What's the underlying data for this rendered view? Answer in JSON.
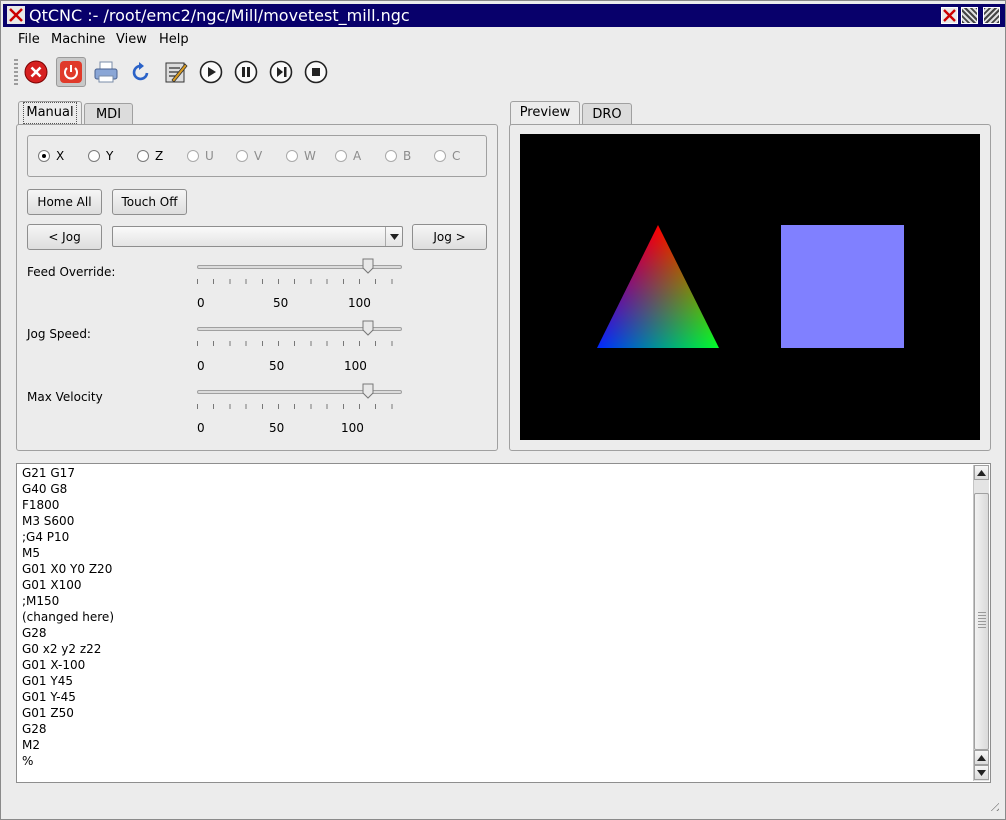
{
  "window": {
    "title": "QtCNC :- /root/emc2/ngc/Mill/movetest_mill.ngc",
    "colors": {
      "titlebar": "#08006b",
      "preview_bg": "#000000",
      "square": "#8080ff"
    }
  },
  "menu": [
    {
      "label": "File"
    },
    {
      "label": "Machine"
    },
    {
      "label": "View"
    },
    {
      "label": "Help"
    }
  ],
  "toolbar": {
    "icons": [
      "estop-icon",
      "power-icon",
      "print-icon",
      "reload-icon",
      "edit-icon",
      "run-icon",
      "pause-icon",
      "step-icon",
      "stop-icon"
    ]
  },
  "left_tabs": [
    {
      "label": "Manual",
      "selected": true
    },
    {
      "label": "MDI",
      "selected": false
    }
  ],
  "axes": [
    {
      "label": "X",
      "checked": true,
      "enabled": true
    },
    {
      "label": "Y",
      "checked": false,
      "enabled": true
    },
    {
      "label": "Z",
      "checked": false,
      "enabled": true
    },
    {
      "label": "U",
      "checked": false,
      "enabled": false
    },
    {
      "label": "V",
      "checked": false,
      "enabled": false
    },
    {
      "label": "W",
      "checked": false,
      "enabled": false
    },
    {
      "label": "A",
      "checked": false,
      "enabled": false
    },
    {
      "label": "B",
      "checked": false,
      "enabled": false
    },
    {
      "label": "C",
      "checked": false,
      "enabled": false
    }
  ],
  "buttons": {
    "home_all": "Home All",
    "touch_off": "Touch Off",
    "jog_minus": "< Jog",
    "jog_plus": "Jog >"
  },
  "jog_increment": {
    "value": ""
  },
  "sliders": [
    {
      "label": "Feed Override:",
      "value": 100,
      "max": 120,
      "ticks": [
        "0",
        "50",
        "100"
      ]
    },
    {
      "label": "Jog Speed:",
      "value": 100,
      "max": 120,
      "ticks": [
        "0",
        "50",
        "100"
      ]
    },
    {
      "label": "Max Velocity",
      "value": 100,
      "max": 120,
      "ticks": [
        "0",
        "50",
        "100"
      ]
    }
  ],
  "right_tabs": [
    {
      "label": "Preview",
      "selected": true
    },
    {
      "label": "DRO",
      "selected": false
    }
  ],
  "gcode_lines": [
    "G21 G17",
    "G40 G8",
    "F1800",
    "M3 S600",
    ";G4 P10",
    "M5",
    "G01 X0 Y0 Z20",
    "G01 X100",
    ";M150",
    "(changed here)",
    "G28",
    "G0 x2 y2 z22",
    "G01 X-100",
    "G01 Y45",
    "G01 Y-45",
    "G01 Z50",
    "G28",
    "M2",
    "%"
  ]
}
